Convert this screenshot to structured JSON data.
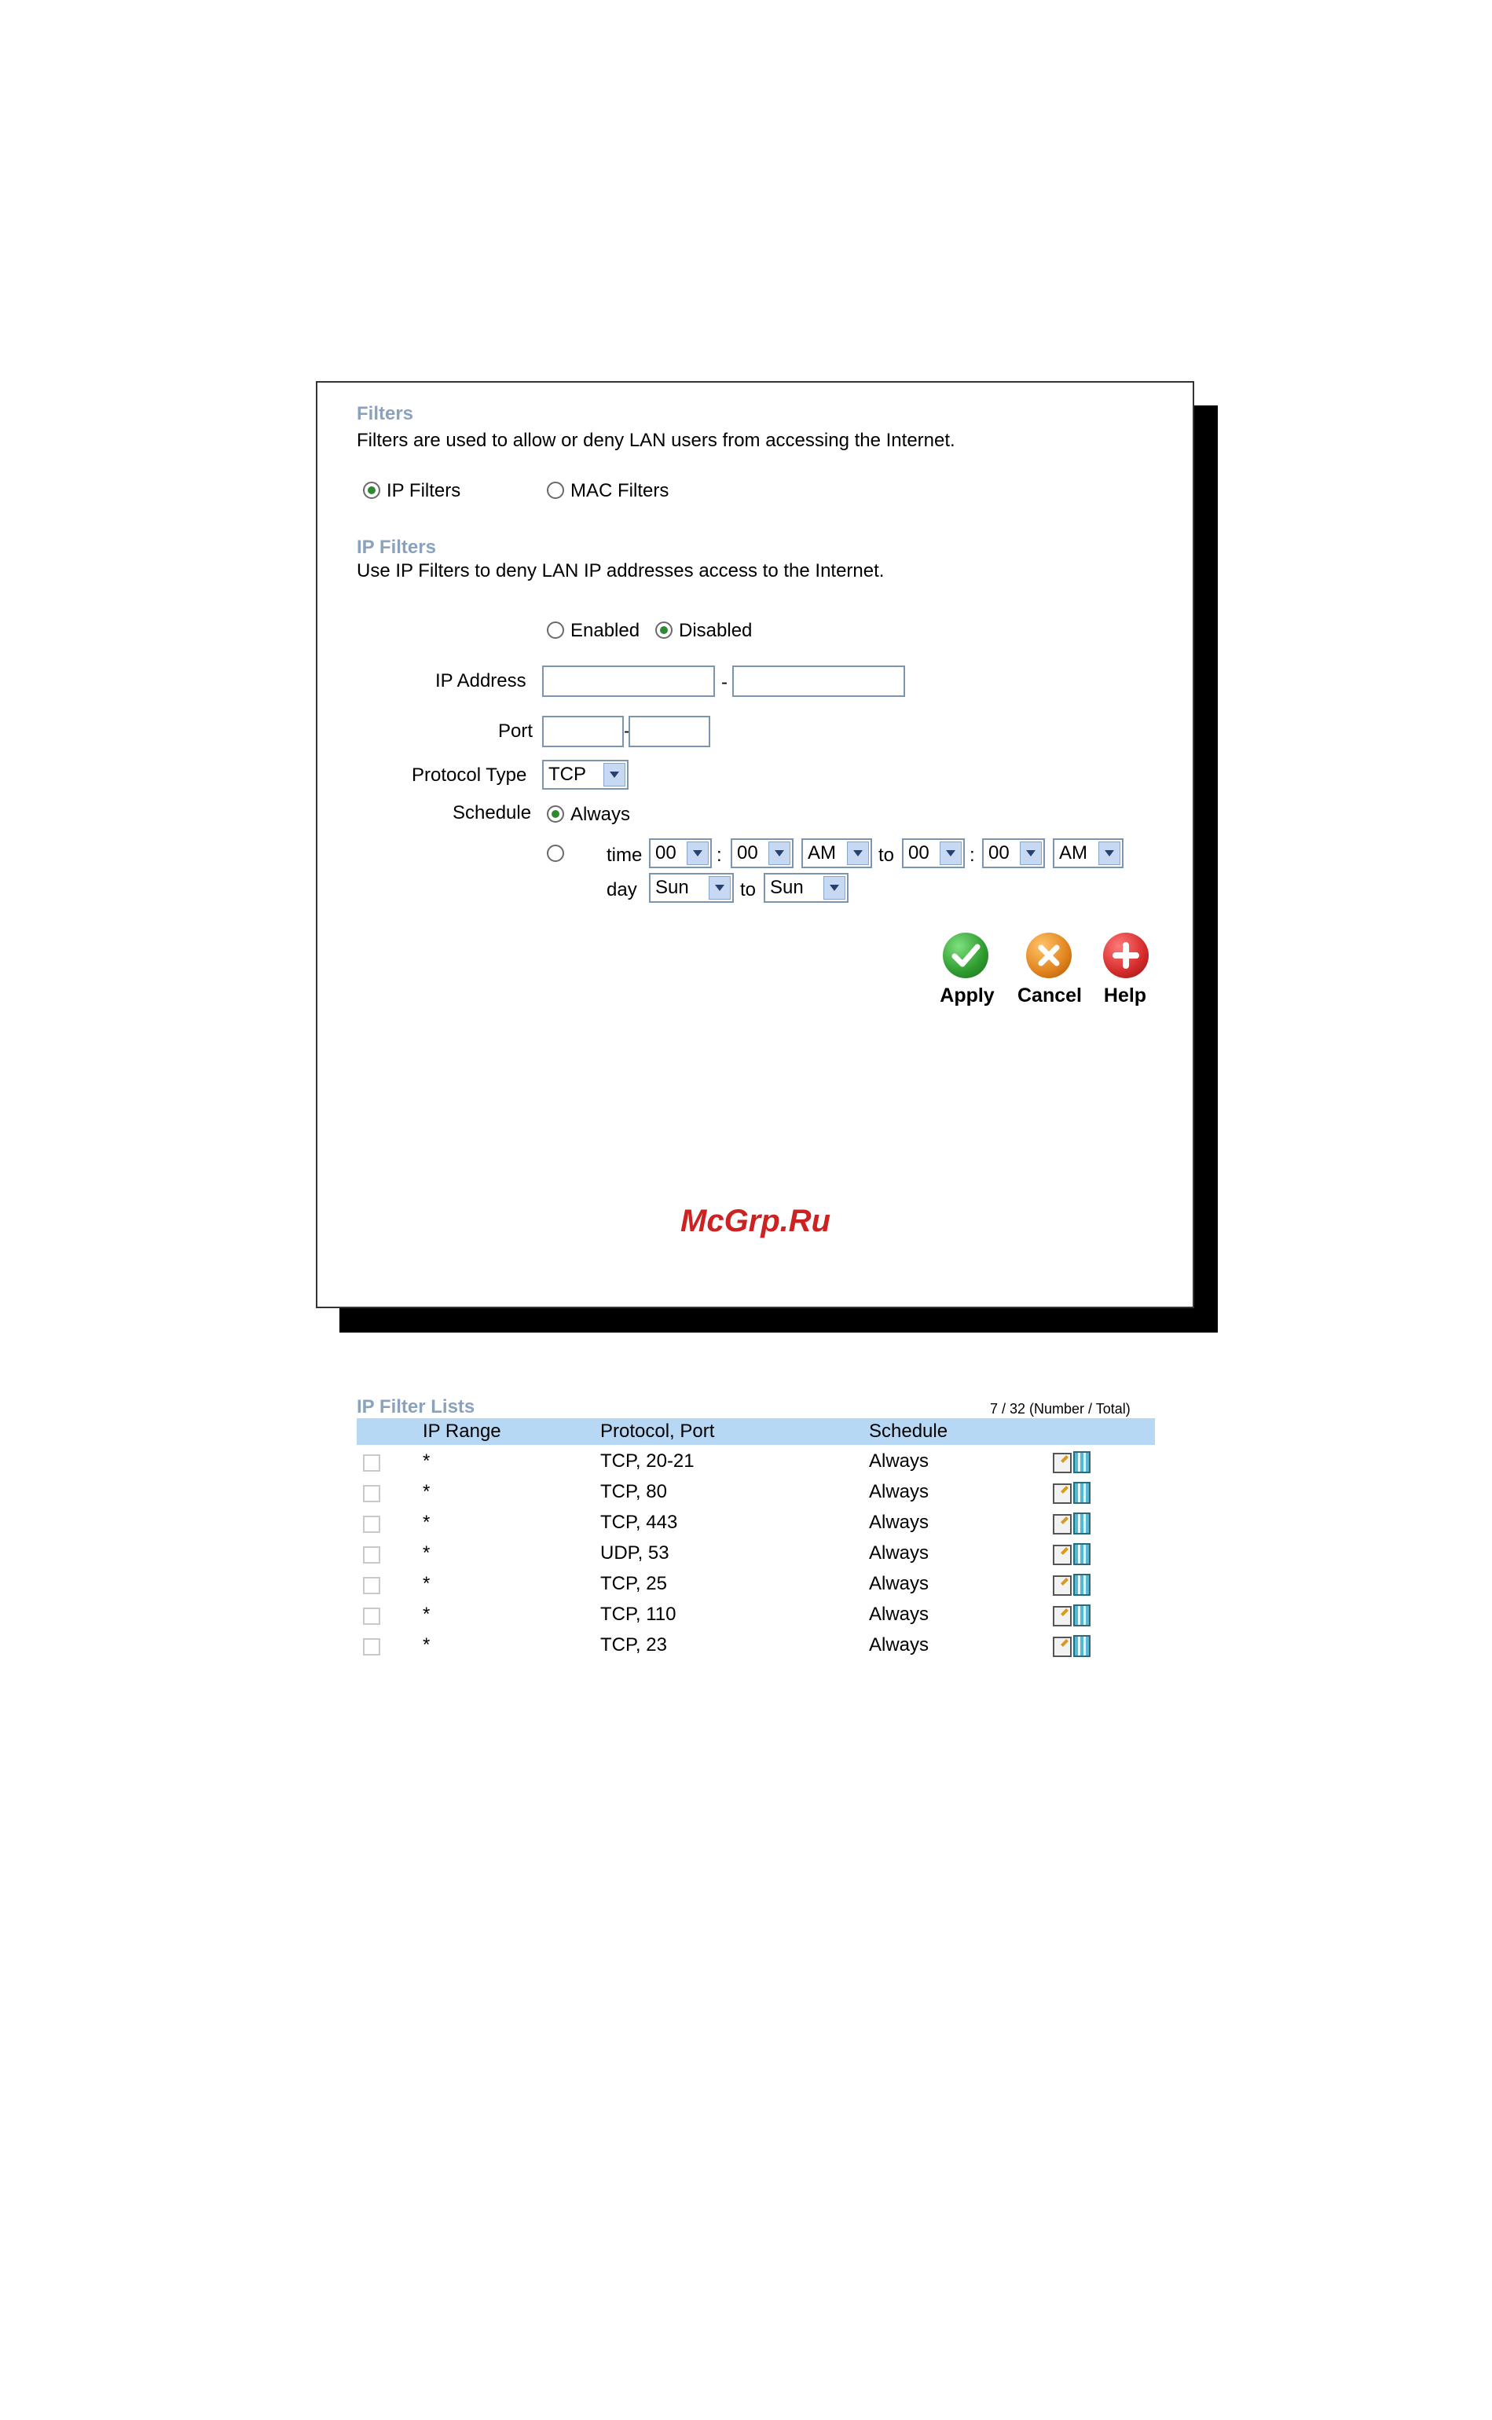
{
  "filters": {
    "title": "Filters",
    "description": "Filters are used to allow or deny LAN users from accessing the Internet.",
    "options": [
      "IP Filters",
      "MAC Filters"
    ],
    "selected": "IP Filters"
  },
  "ip_filters": {
    "title": "IP Filters",
    "description": "Use IP Filters to deny LAN IP addresses access to the Internet.",
    "enabled_label": "Enabled",
    "disabled_label": "Disabled",
    "state": "Disabled",
    "ip_address_label": "IP Address",
    "ip_dash": "-",
    "ip_start": "",
    "ip_end": "",
    "port_label": "Port",
    "port_dash": "-",
    "port_start": "",
    "port_end": "",
    "protocol_label": "Protocol Type",
    "protocol_value": "TCP",
    "schedule_label": "Schedule",
    "always_label": "Always",
    "schedule_mode": "Always",
    "time_label": "time",
    "day_label": "day",
    "to_label": "to",
    "colon": ":",
    "time_start_hour": "00",
    "time_start_min": "00",
    "time_start_ampm": "AM",
    "time_end_hour": "00",
    "time_end_min": "00",
    "time_end_ampm": "AM",
    "day_start": "Sun",
    "day_end": "Sun"
  },
  "buttons": {
    "apply": "Apply",
    "cancel": "Cancel",
    "help": "Help"
  },
  "list": {
    "title": "IP Filter Lists",
    "count": "7 / 32 (Number / Total)",
    "columns": [
      "IP Range",
      "Protocol, Port",
      "Schedule"
    ],
    "rows": [
      {
        "ip_range": "*",
        "protocol_port": "TCP, 20-21",
        "schedule": "Always"
      },
      {
        "ip_range": "*",
        "protocol_port": "TCP, 80",
        "schedule": "Always"
      },
      {
        "ip_range": "*",
        "protocol_port": "TCP, 443",
        "schedule": "Always"
      },
      {
        "ip_range": "*",
        "protocol_port": "UDP, 53",
        "schedule": "Always"
      },
      {
        "ip_range": "*",
        "protocol_port": "TCP, 25",
        "schedule": "Always"
      },
      {
        "ip_range": "*",
        "protocol_port": "TCP, 110",
        "schedule": "Always"
      },
      {
        "ip_range": "*",
        "protocol_port": "TCP, 23",
        "schedule": "Always"
      }
    ]
  },
  "watermark": "McGrp.Ru",
  "colors": {
    "section_title": "#8aa2bd",
    "list_header_bg": "#b6d8f5",
    "apply": "#2e9a2e",
    "cancel": "#e0821c",
    "help": "#d42a2a"
  }
}
